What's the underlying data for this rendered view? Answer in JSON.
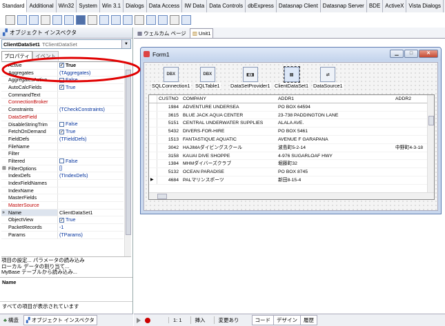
{
  "palette": {
    "tabs": [
      "Standard",
      "Additional",
      "Win32",
      "System",
      "Win 3.1",
      "Dialogs",
      "Data Access",
      "IW Data",
      "Data Controls",
      "dbExpress",
      "Datasnap Client",
      "Datasnap Server",
      "BDE",
      "ActiveX",
      "Vista Dialogs",
      "Sample"
    ]
  },
  "inspector": {
    "title": "オブジェクト インスペクタ",
    "component_name": "ClientDataSet1",
    "component_type": "TClientDataSet",
    "tab_properties": "プロパティ",
    "tab_events": "イベント",
    "properties": [
      {
        "name": "Active",
        "value": "True",
        "check": true,
        "bold": true
      },
      {
        "name": "Aggregates",
        "value": "(TAggregates)"
      },
      {
        "name": "AggregatesActive",
        "value": "False",
        "check": false
      },
      {
        "name": "AutoCalcFields",
        "value": "True",
        "check": true
      },
      {
        "name": "CommandText",
        "value": ""
      },
      {
        "name": "ConnectionBroker",
        "value": "",
        "event": true
      },
      {
        "name": "Constraints",
        "value": "(TCheckConstraints)"
      },
      {
        "name": "DataSetField",
        "value": "",
        "event": true
      },
      {
        "name": "DisableStringTrim",
        "value": "False",
        "check": false
      },
      {
        "name": "FetchOnDemand",
        "value": "True",
        "check": true
      },
      {
        "name": "FieldDefs",
        "value": "(TFieldDefs)"
      },
      {
        "name": "FileName",
        "value": ""
      },
      {
        "name": "Filter",
        "value": ""
      },
      {
        "name": "Filtered",
        "value": "False",
        "check": false
      },
      {
        "name": "FilterOptions",
        "value": "[]",
        "marker": "⊞"
      },
      {
        "name": "IndexDefs",
        "value": "(TIndexDefs)"
      },
      {
        "name": "IndexFieldNames",
        "value": ""
      },
      {
        "name": "IndexName",
        "value": ""
      },
      {
        "name": "MasterFields",
        "value": ""
      },
      {
        "name": "MasterSource",
        "value": "",
        "event": true
      },
      {
        "name": "Name",
        "value": "ClientDataSet1",
        "marker": "»",
        "selected": true,
        "plain": true
      },
      {
        "name": "ObjectView",
        "value": "True",
        "check": true
      },
      {
        "name": "PacketRecords",
        "value": "-1"
      },
      {
        "name": "Params",
        "value": "(TParams)"
      }
    ],
    "actions": [
      "項目の設定... パラメータの読み込み",
      "ローカル データの割り当て...",
      "MyBase テーブルから読み込み..."
    ],
    "desc_name": "Name",
    "status": "すべての項目が表示されています"
  },
  "bottom_tabs": {
    "structure": "構造",
    "inspector": "オブジェクト インスペクタ"
  },
  "editor": {
    "welcome_tab": "ウェルカム ページ",
    "unit_tab": "Unit1"
  },
  "form": {
    "title": "Form1",
    "components": [
      {
        "label": "SQLConnection1",
        "glyph": "DBX"
      },
      {
        "label": "SQLTable1",
        "glyph": "DBX"
      },
      {
        "label": "DataSetProvider1",
        "glyph": "◧◨"
      },
      {
        "label": "ClientDataSet1",
        "glyph": "▤",
        "selected": true
      },
      {
        "label": "DataSource1",
        "glyph": "⇄"
      }
    ],
    "grid": {
      "columns": [
        "CUSTNO",
        "COMPANY",
        "ADDR1",
        "ADDR2"
      ],
      "rows": [
        [
          "1984",
          "ADVENTURE UNDERSEA",
          "PO BOX 64594",
          ""
        ],
        [
          "3615",
          "BLUE JACK AQUA CENTER",
          "23-738 PADDINGTON LANE",
          ""
        ],
        [
          "5151",
          "CENTRAL UNDERWATER SUPPLIES",
          "ALALA AVE.",
          ""
        ],
        [
          "5432",
          "DIVERS-FOR-HIRE",
          "PO BOX 5461",
          ""
        ],
        [
          "1513",
          "FANTASTIQUE AQUATIC",
          "AVENUE F GARAPANA",
          ""
        ],
        [
          "3042",
          "HAJIMAダイビングスクール",
          "波島町5-2-14",
          "中野町4-3-18"
        ],
        [
          "3158",
          "KAUAI DIVE SHOPPE",
          "4-976 SUGARLOAF HWY",
          ""
        ],
        [
          "1384",
          "MHMダイバーズクラブ",
          "堀藤町32",
          ""
        ],
        [
          "5132",
          "OCEAN PARADISE",
          "PO BOX 8745",
          ""
        ],
        [
          "4684",
          "PALマリンスポーツ",
          "新田8-15-4",
          ""
        ]
      ]
    }
  },
  "statusbar": {
    "position": "1: 1",
    "mode": "挿入",
    "modified": "変更あり",
    "tabs": [
      "コード",
      "デザイン",
      "履歴"
    ]
  }
}
